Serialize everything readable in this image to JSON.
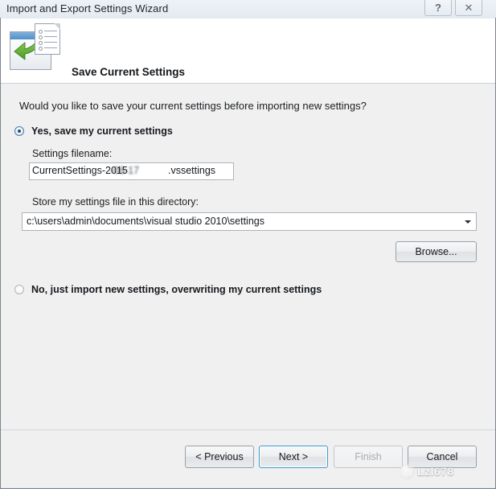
{
  "window": {
    "title": "Import and Export Settings Wizard",
    "help_button_label": "?",
    "close_button_label": "✕"
  },
  "header": {
    "title": "Save Current Settings",
    "icon": "save-settings-wizard-icon"
  },
  "main": {
    "question": "Would you like to save your current settings before importing new settings?",
    "options": [
      {
        "id": "yes",
        "label": "Yes, save my current settings",
        "selected": true
      },
      {
        "id": "no",
        "label": "No, just import new settings, overwriting my current settings",
        "selected": false
      }
    ],
    "filename_field": {
      "label": "Settings filename:",
      "value_prefix": "CurrentSettings-2015",
      "value_obscured": "-06-17",
      "value_suffix": ".vssettings",
      "full_value": "CurrentSettings-2015-06-17.vssettings"
    },
    "directory_field": {
      "label": "Store my settings file in this directory:",
      "value": "c:\\users\\admin\\documents\\visual studio 2010\\settings",
      "dropdown_icon": "chevron-down-icon"
    },
    "browse_button_label": "Browse..."
  },
  "footer": {
    "buttons": [
      {
        "id": "previous",
        "label": "< Previous",
        "enabled": true,
        "focused": false
      },
      {
        "id": "next",
        "label": "Next >",
        "enabled": true,
        "focused": true
      },
      {
        "id": "finish",
        "label": "Finish",
        "enabled": false,
        "focused": false
      },
      {
        "id": "cancel",
        "label": "Cancel",
        "enabled": true,
        "focused": false
      }
    ]
  },
  "watermark": {
    "text": "Lzl678",
    "logo": "circular-logo-icon"
  },
  "colors": {
    "window_background": "#f0f0f0",
    "header_background": "#ffffff",
    "titlebar_background": "#eef2f7",
    "focus_border": "#3d9ad1",
    "radio_selected": "#1f4e79",
    "accent_green": "#6cbb3c",
    "accent_blue": "#4f8fc8",
    "disabled_text": "#a8abae"
  }
}
